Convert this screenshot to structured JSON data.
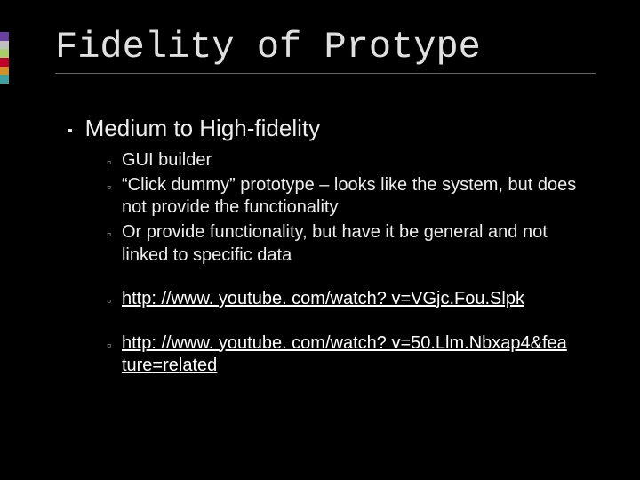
{
  "title": "Fidelity of Protype",
  "heading": "Medium to High-fidelity",
  "items": {
    "a": "GUI builder",
    "b": "“Click dummy” prototype – looks like the system, but does not provide the functionality",
    "c": "Or provide functionality, but have it be general and not linked to specific data",
    "d": "http: //www. youtube. com/watch? v=VGjc.Fou.Slpk",
    "e": "http: //www. youtube. com/watch? v=50.Llm.Nbxap4&fea ture=related"
  }
}
